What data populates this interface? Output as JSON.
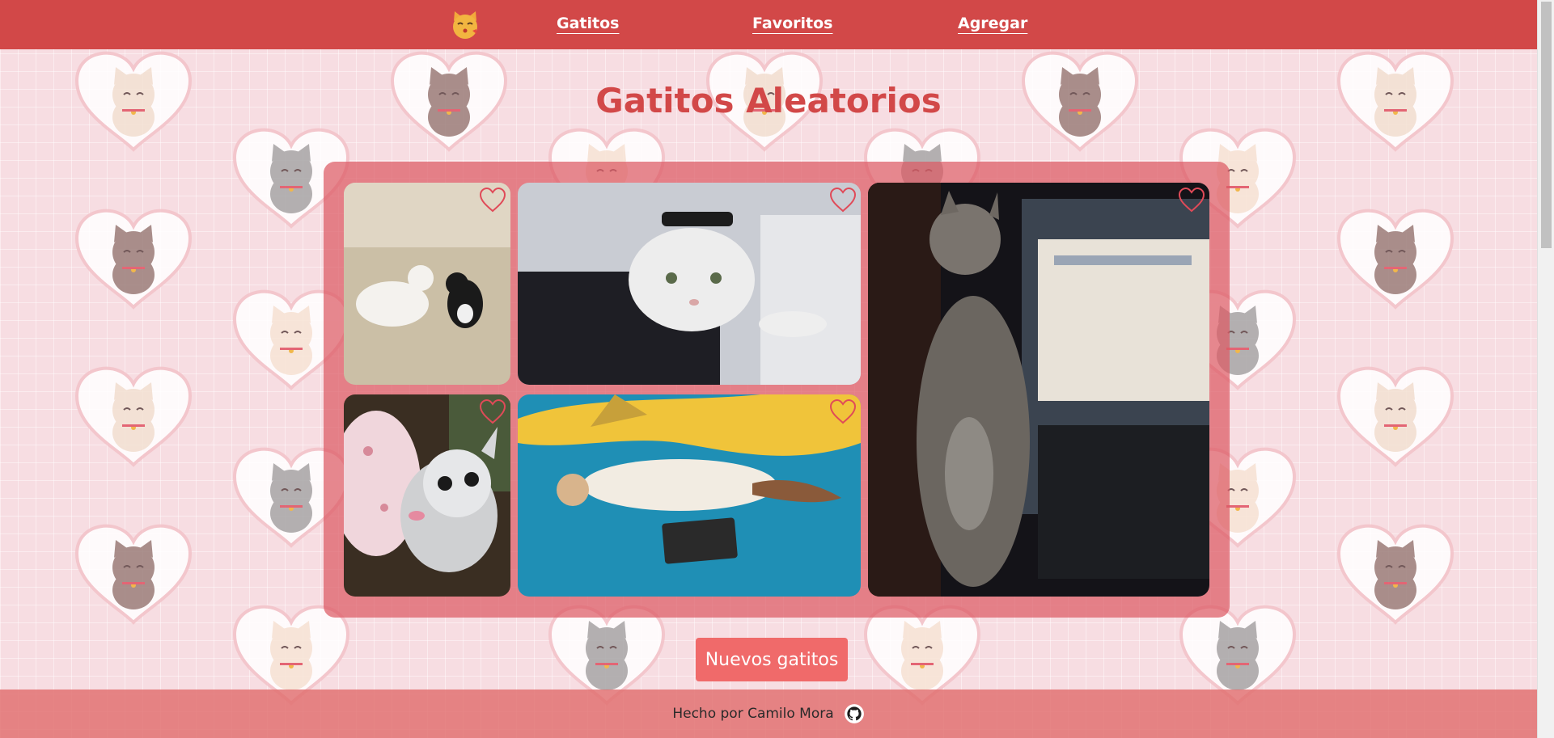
{
  "nav": {
    "items": [
      {
        "label": "Gatitos"
      },
      {
        "label": "Favoritos"
      },
      {
        "label": "Agregar"
      }
    ]
  },
  "page": {
    "title": "Gatitos Aleatorios"
  },
  "gallery": {
    "cats": [
      {
        "name": "white and black cats in snow",
        "favorited": false
      },
      {
        "name": "white cat with hat",
        "favorited": false
      },
      {
        "name": "tabby kitten looking up",
        "favorited": false
      },
      {
        "name": "kitten licking",
        "favorited": false
      },
      {
        "name": "cat lying on blue bed",
        "favorited": false
      }
    ]
  },
  "actions": {
    "new_cats_label": "Nuevos gatitos"
  },
  "footer": {
    "credit": "Hecho por Camilo Mora"
  },
  "colors": {
    "brand": "#d24848",
    "button": "#f06a6a",
    "background": "#f7dde2"
  },
  "icons": {
    "logo": "kissing-cat-icon",
    "favorite": "heart-outline-icon",
    "github": "github-icon"
  }
}
